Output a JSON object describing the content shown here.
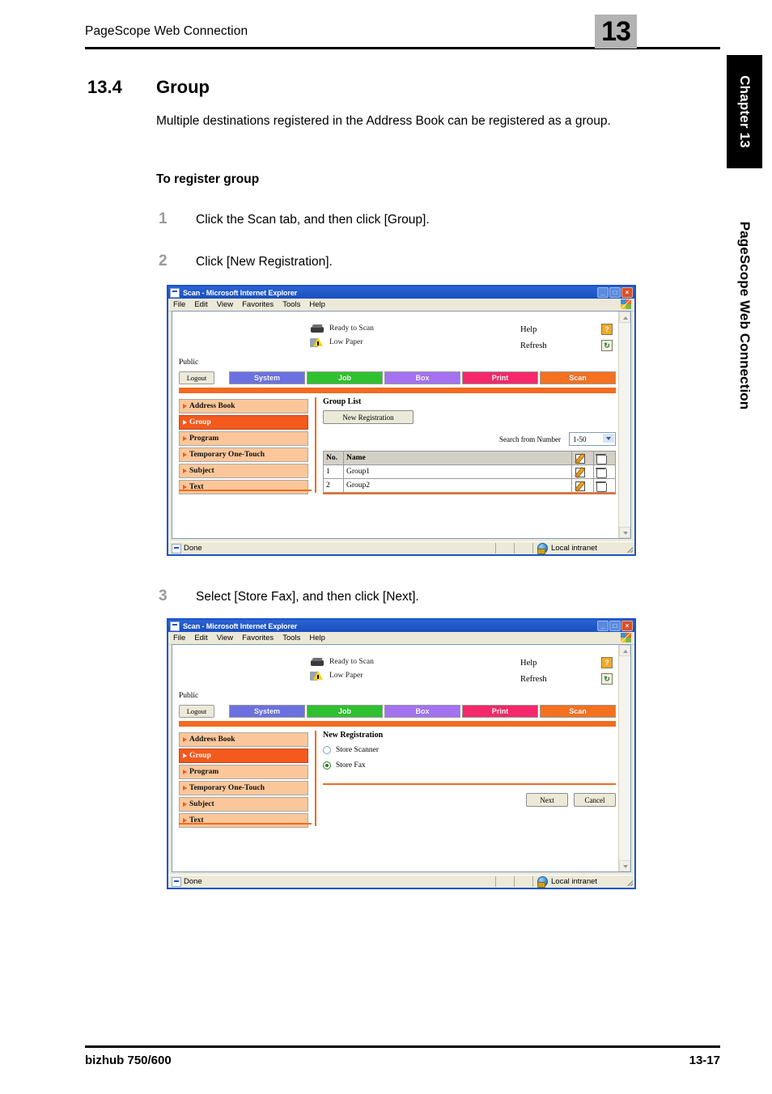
{
  "header": {
    "title": "PageScope Web Connection",
    "chapter_number": "13"
  },
  "side_tabs": {
    "chapter_tab": "Chapter 13",
    "book_tab": "PageScope Web Connection"
  },
  "section": {
    "number": "13.4",
    "title": "Group",
    "body": "Multiple destinations registered in the Address Book can be registered as a group.",
    "subhead": "To register group"
  },
  "steps": [
    {
      "num": "1",
      "text": "Click the Scan tab, and then click [Group]."
    },
    {
      "num": "2",
      "text": "Click [New Registration]."
    },
    {
      "num": "3",
      "text": "Select [Store Fax], and then click [Next]."
    }
  ],
  "footer": {
    "left": "bizhub 750/600",
    "right": "13-17"
  },
  "browser": {
    "title": "Scan - Microsoft Internet Explorer",
    "menu": [
      "File",
      "Edit",
      "View",
      "Favorites",
      "Tools",
      "Help"
    ],
    "window_buttons": [
      "minimize",
      "maximize",
      "close"
    ],
    "status_text": "Done",
    "status_zone": "Local intranet"
  },
  "app": {
    "status_items": [
      {
        "icon": "printer-icon",
        "label": "Ready to Scan"
      },
      {
        "icon": "warning-icon",
        "label": "Low Paper"
      }
    ],
    "help_items": [
      {
        "label": "Help",
        "icon": "help-icon",
        "glyph": "?"
      },
      {
        "label": "Refresh",
        "icon": "refresh-icon",
        "glyph": "↻"
      }
    ],
    "user": "Public",
    "logout_label": "Logout",
    "tabs": [
      {
        "label": "System",
        "color": "#6b71e0"
      },
      {
        "label": "Job",
        "color": "#2fc12f"
      },
      {
        "label": "Box",
        "color": "#a472f0"
      },
      {
        "label": "Print",
        "color": "#f5286b"
      },
      {
        "label": "Scan",
        "color": "#f4711f"
      }
    ],
    "sidebar": [
      {
        "label": "Address Book",
        "active": false
      },
      {
        "label": "Group",
        "active": true
      },
      {
        "label": "Program",
        "active": false
      },
      {
        "label": "Temporary One-Touch",
        "active": false
      },
      {
        "label": "Subject",
        "active": false
      },
      {
        "label": "Text",
        "active": false
      }
    ],
    "accent_color": "#f26b21"
  },
  "screen1": {
    "main_title": "Group List",
    "new_registration_label": "New Registration",
    "search_label": "Search from Number",
    "search_value": "1-50",
    "columns": [
      "No.",
      "Name"
    ],
    "rows": [
      {
        "no": "1",
        "name": "Group1"
      },
      {
        "no": "2",
        "name": "Group2"
      }
    ],
    "edit_icon": "pencil-icon",
    "delete_icon": "trash-icon"
  },
  "screen2": {
    "main_title": "New Registration",
    "options": [
      {
        "label": "Store Scanner",
        "selected": false
      },
      {
        "label": "Store Fax",
        "selected": true
      }
    ],
    "next_label": "Next",
    "cancel_label": "Cancel"
  }
}
